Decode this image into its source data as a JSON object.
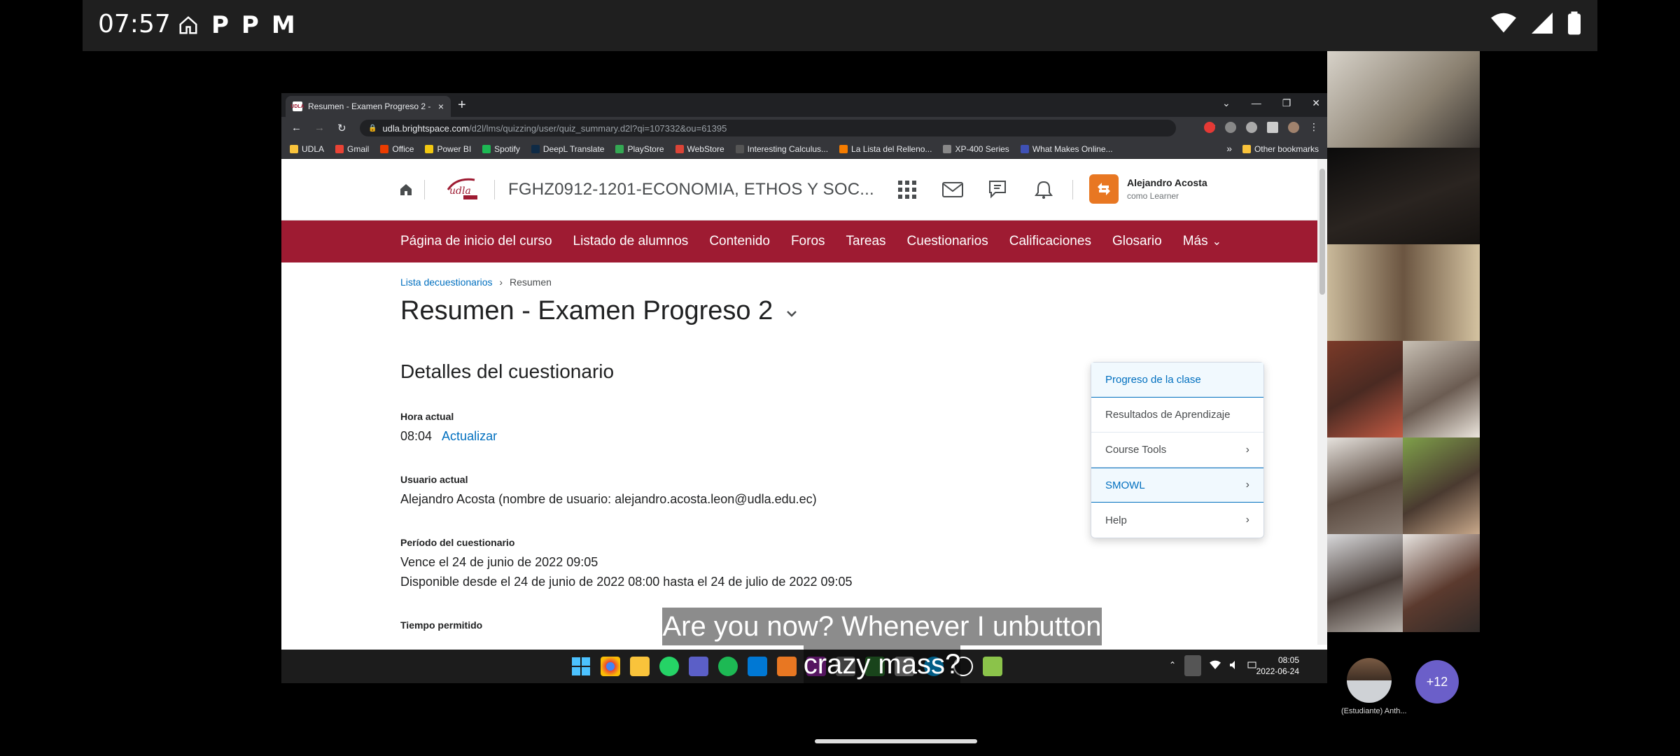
{
  "android": {
    "time": "07:57",
    "status_glyph_1": "P",
    "status_glyph_2": "P",
    "status_glyph_3": "M"
  },
  "browser": {
    "tab_favicon": "UDLA",
    "tab_title": "Resumen - Examen Progreso 2 -",
    "tab_close": "×",
    "new_tab": "+",
    "win_min": "—",
    "win_restore": "❐",
    "win_close": "✕",
    "nav_back": "←",
    "nav_forward": "→",
    "nav_reload": "↻",
    "lock": "🔒",
    "url_host": "udla.brightspace.com",
    "url_path": "/d2l/lms/quizzing/user/quiz_summary.d2l?qi=107332&ou=61395",
    "share": "⇪",
    "star": "☆",
    "more": "⋮",
    "bookmarks": [
      {
        "label": "UDLA",
        "color": "#f9c33b"
      },
      {
        "label": "Gmail",
        "color": "#ea4335"
      },
      {
        "label": "Office",
        "color": "#eb3c00"
      },
      {
        "label": "Power BI",
        "color": "#f2c811"
      },
      {
        "label": "Spotify",
        "color": "#1db954"
      },
      {
        "label": "DeepL Translate",
        "color": "#0f2b46"
      },
      {
        "label": "PlayStore",
        "color": "#34a853"
      },
      {
        "label": "WebStore",
        "color": "#db4437"
      },
      {
        "label": "Interesting Calculus...",
        "color": "#555555"
      },
      {
        "label": "La Lista del Relleno...",
        "color": "#f57c00"
      },
      {
        "label": "XP-400 Series",
        "color": "#888888"
      },
      {
        "label": "What Makes Online...",
        "color": "#3f51b5"
      }
    ],
    "bookmarks_overflow": "»",
    "other_bookmarks": "Other bookmarks"
  },
  "brightspace": {
    "course_title": "FGHZ0912-1201-ECONOMIA, ETHOS Y SOC...",
    "user_name": "Alejandro Acosta",
    "user_role": "como Learner",
    "nav": [
      "Página de inicio del curso",
      "Listado de alumnos",
      "Contenido",
      "Foros",
      "Tareas",
      "Cuestionarios",
      "Calificaciones",
      "Glosario",
      "Más"
    ],
    "nav_more_chevron": "⌄",
    "breadcrumb": {
      "parent": "Lista decuestionarios",
      "separator": "›",
      "current": "Resumen"
    },
    "page_title": "Resumen - Examen Progreso 2",
    "section_title": "Detalles del cuestionario",
    "hora_label": "Hora actual",
    "hora_value": "08:04",
    "actualizar": "Actualizar",
    "usuario_label": "Usuario actual",
    "usuario_value": "Alejandro Acosta (nombre de usuario: alejandro.acosta.leon@udla.edu.ec)",
    "periodo_label": "Período del cuestionario",
    "periodo_line1": "Vence el 24 de junio de 2022 09:05",
    "periodo_line2": "Disponible desde el 24 de junio de 2022 08:00 hasta el 24 de julio de 2022 09:05",
    "tiempo_label": "Tiempo permitido",
    "dropdown": [
      {
        "label": "Progreso de la clase",
        "chevron": ""
      },
      {
        "label": "Resultados de Aprendizaje",
        "chevron": ""
      },
      {
        "label": "Course Tools",
        "chevron": "›"
      },
      {
        "label": "SMOWL",
        "chevron": "›"
      },
      {
        "label": "Help",
        "chevron": "›"
      }
    ]
  },
  "taskbar": {
    "tray_chevron": "⌃",
    "clock_time": "08:05",
    "clock_date": "2022-06-24"
  },
  "caption": {
    "line1": "Are you now? Whenever I unbutton",
    "line2": "crazy mass?"
  },
  "meeting": {
    "self_label": "(Estudiante) Anth...",
    "more_count": "+12"
  },
  "colors": {
    "nav_bar": "#9e1b32",
    "link": "#006fbf",
    "avatar_orange": "#e87722",
    "more_badge": "#6b5fc9"
  }
}
